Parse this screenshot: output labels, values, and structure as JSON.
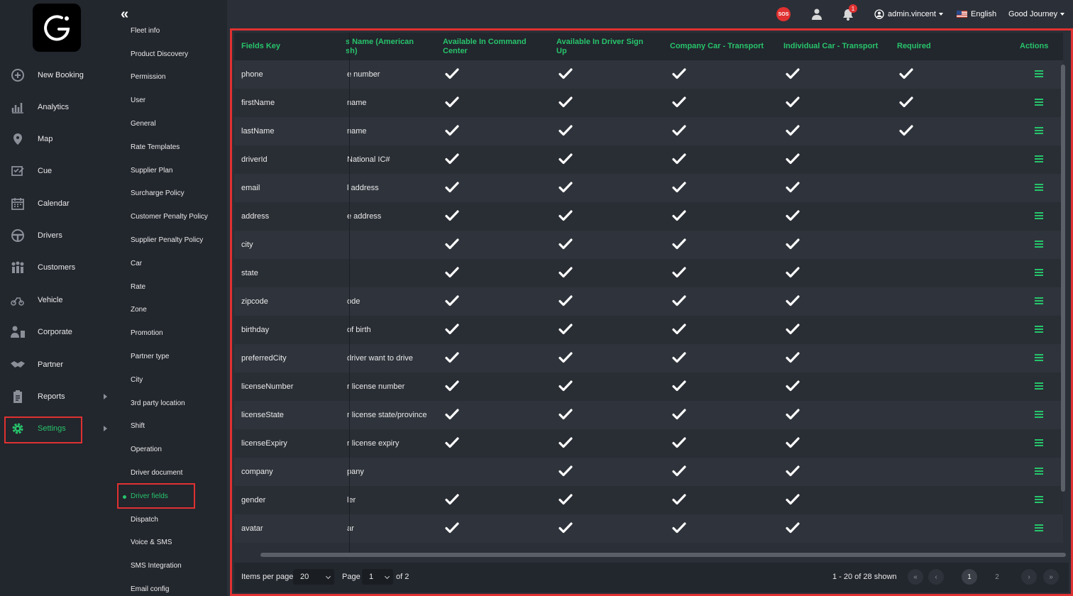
{
  "nav": {
    "items": [
      {
        "label": "New Booking",
        "icon": "plus-circle-icon"
      },
      {
        "label": "Analytics",
        "icon": "chart-icon"
      },
      {
        "label": "Map",
        "icon": "map-pin-icon"
      },
      {
        "label": "Cue",
        "icon": "list-check-icon"
      },
      {
        "label": "Calendar",
        "icon": "calendar-icon"
      },
      {
        "label": "Drivers",
        "icon": "steering-wheel-icon"
      },
      {
        "label": "Customers",
        "icon": "users-icon"
      },
      {
        "label": "Vehicle",
        "icon": "car-icon"
      },
      {
        "label": "Corporate",
        "icon": "corporate-icon"
      },
      {
        "label": "Partner",
        "icon": "handshake-icon"
      },
      {
        "label": "Reports",
        "icon": "clipboard-icon"
      },
      {
        "label": "Settings",
        "icon": "gear-icon"
      }
    ]
  },
  "submenu": {
    "items": [
      "Fleet info",
      "Product Discovery",
      "Permission",
      "User",
      "General",
      "Rate Templates",
      "Supplier Plan",
      "Surcharge Policy",
      "Customer Penalty Policy",
      "Supplier Penalty Policy",
      "Car",
      "Rate",
      "Zone",
      "Promotion",
      "Partner type",
      "City",
      "3rd party location",
      "Shift",
      "Operation",
      "Driver document",
      "Driver fields",
      "Dispatch",
      "Voice & SMS",
      "SMS Integration",
      "Email config"
    ]
  },
  "topbar": {
    "sos": "SOS",
    "notification_count": "1",
    "user": "admin.vincent",
    "language": "English",
    "company": "Good Journey"
  },
  "table": {
    "headers": {
      "key": "Fields Key",
      "name_line1": "s Name (American",
      "name_line2": "sh)",
      "cc_line1": "Available In Command",
      "cc_line2": "Center",
      "signup_line1": "Available In Driver Sign",
      "signup_line2": "Up",
      "company": "Company Car - Transport",
      "individual": "Individual Car - Transport",
      "required": "Required",
      "actions": "Actions"
    },
    "rows": [
      {
        "key": "phone",
        "name": "e number",
        "cc": true,
        "signup": true,
        "company": true,
        "individual": true,
        "required": true
      },
      {
        "key": "firstName",
        "name": "name",
        "cc": true,
        "signup": true,
        "company": true,
        "individual": true,
        "required": true
      },
      {
        "key": "lastName",
        "name": "name",
        "cc": true,
        "signup": true,
        "company": true,
        "individual": true,
        "required": true
      },
      {
        "key": "driverId",
        "name": " National IC#",
        "cc": true,
        "signup": true,
        "company": true,
        "individual": true,
        "required": false
      },
      {
        "key": "email",
        "name": "l address",
        "cc": true,
        "signup": true,
        "company": true,
        "individual": true,
        "required": false
      },
      {
        "key": "address",
        "name": "e address",
        "cc": true,
        "signup": true,
        "company": true,
        "individual": true,
        "required": false
      },
      {
        "key": "city",
        "name": "",
        "cc": true,
        "signup": true,
        "company": true,
        "individual": true,
        "required": false
      },
      {
        "key": "state",
        "name": "",
        "cc": true,
        "signup": true,
        "company": true,
        "individual": true,
        "required": false
      },
      {
        "key": "zipcode",
        "name": "ode",
        "cc": true,
        "signup": true,
        "company": true,
        "individual": true,
        "required": false
      },
      {
        "key": "birthday",
        "name": "of birth",
        "cc": true,
        "signup": true,
        "company": true,
        "individual": true,
        "required": false
      },
      {
        "key": "preferredCity",
        "name": "driver want to drive",
        "cc": true,
        "signup": true,
        "company": true,
        "individual": true,
        "required": false
      },
      {
        "key": "licenseNumber",
        "name": "r license number",
        "cc": true,
        "signup": true,
        "company": true,
        "individual": true,
        "required": false
      },
      {
        "key": "licenseState",
        "name": "r license state/province",
        "cc": true,
        "signup": true,
        "company": true,
        "individual": true,
        "required": false
      },
      {
        "key": "licenseExpiry",
        "name": "r license expiry",
        "cc": true,
        "signup": true,
        "company": true,
        "individual": true,
        "required": false
      },
      {
        "key": "company",
        "name": "pany",
        "cc": false,
        "signup": true,
        "company": true,
        "individual": true,
        "required": false
      },
      {
        "key": "gender",
        "name": "ler",
        "cc": true,
        "signup": true,
        "company": true,
        "individual": true,
        "required": false
      },
      {
        "key": "avatar",
        "name": "ar",
        "cc": true,
        "signup": true,
        "company": true,
        "individual": true,
        "required": false
      }
    ]
  },
  "footer": {
    "items_per_page_label": "Items per page",
    "items_per_page_value": "20",
    "page_label": "Page",
    "page_value": "1",
    "of_label": "of 2",
    "shown_text": "1 - 20 of 28 shown",
    "first": "«",
    "prev": "‹",
    "page1": "1",
    "page2": "2",
    "next": "›",
    "last": "»"
  },
  "colors": {
    "accent": "#27c46b",
    "highlight": "#e03131",
    "background": "#2b2f37",
    "sidebar": "#22262d"
  }
}
